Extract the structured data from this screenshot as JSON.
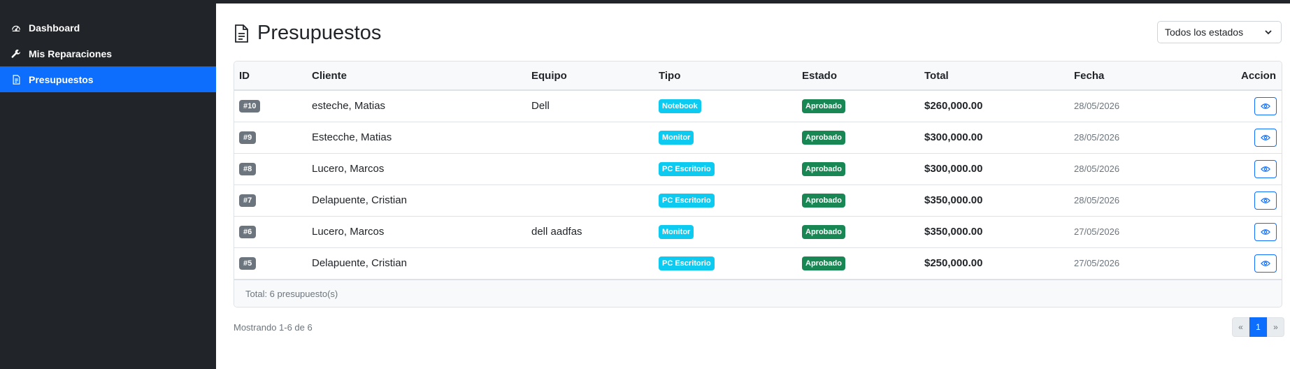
{
  "sidebar": {
    "items": [
      {
        "label": "Dashboard",
        "icon": "speedometer-icon",
        "active": false
      },
      {
        "label": "Mis Reparaciones",
        "icon": "wrench-icon",
        "active": false
      },
      {
        "label": "Presupuestos",
        "icon": "document-icon",
        "active": true
      }
    ]
  },
  "header": {
    "title": "Presupuestos",
    "filter_value": "Todos los estados"
  },
  "table": {
    "columns": [
      "ID",
      "Cliente",
      "Equipo",
      "Tipo",
      "Estado",
      "Total",
      "Fecha",
      "Accion"
    ],
    "rows": [
      {
        "id": "#10",
        "cliente": "esteche, Matias",
        "equipo": "Dell",
        "tipo": "Notebook",
        "estado": "Aprobado",
        "total": "$260,000.00",
        "fecha": "28/05/2026"
      },
      {
        "id": "#9",
        "cliente": "Estecche, Matias",
        "equipo": "",
        "tipo": "Monitor",
        "estado": "Aprobado",
        "total": "$300,000.00",
        "fecha": "28/05/2026"
      },
      {
        "id": "#8",
        "cliente": "Lucero, Marcos",
        "equipo": "",
        "tipo": "PC Escritorio",
        "estado": "Aprobado",
        "total": "$300,000.00",
        "fecha": "28/05/2026"
      },
      {
        "id": "#7",
        "cliente": "Delapuente, Cristian",
        "equipo": "",
        "tipo": "PC Escritorio",
        "estado": "Aprobado",
        "total": "$350,000.00",
        "fecha": "28/05/2026"
      },
      {
        "id": "#6",
        "cliente": "Lucero, Marcos",
        "equipo": "dell aadfas",
        "tipo": "Monitor",
        "estado": "Aprobado",
        "total": "$350,000.00",
        "fecha": "27/05/2026"
      },
      {
        "id": "#5",
        "cliente": "Delapuente, Cristian",
        "equipo": "",
        "tipo": "PC Escritorio",
        "estado": "Aprobado",
        "total": "$250,000.00",
        "fecha": "27/05/2026"
      }
    ],
    "footer": "Total: 6 presupuesto(s)"
  },
  "pagination": {
    "showing": "Mostrando 1-6 de 6",
    "prev": "«",
    "current": "1",
    "next": "»"
  },
  "colors": {
    "sidebar_bg": "#212529",
    "active": "#0d6efd",
    "tipo_badge": "#0dcaf0",
    "estado_badge": "#198754",
    "id_badge": "#6c757d"
  }
}
